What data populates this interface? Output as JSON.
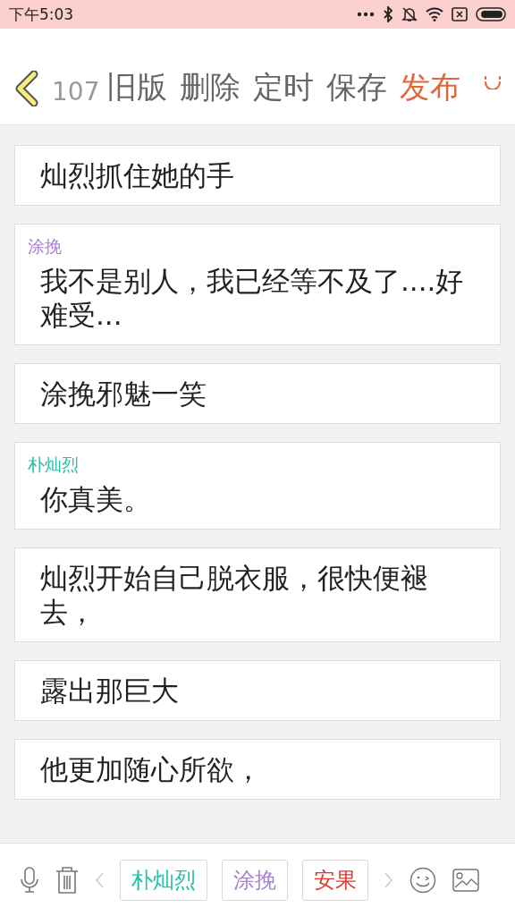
{
  "status_bar": {
    "time": "下午5:03"
  },
  "header": {
    "count": "107",
    "actions": [
      {
        "label": "旧版",
        "kind": "normal"
      },
      {
        "label": "删除",
        "kind": "normal"
      },
      {
        "label": "定时",
        "kind": "normal"
      },
      {
        "label": "保存",
        "kind": "normal"
      },
      {
        "label": "发布",
        "kind": "primary"
      }
    ]
  },
  "messages": [
    {
      "kind": "narration",
      "text": "灿烈抓住她的手"
    },
    {
      "kind": "dialogue",
      "speaker": "涂挽",
      "color": "#a97fd6",
      "text": "我不是别人，我已经等不及了....好难受..."
    },
    {
      "kind": "narration",
      "text": "涂挽邪魅一笑"
    },
    {
      "kind": "dialogue",
      "speaker": "朴灿烈",
      "color": "#2bbfa6",
      "text": "你真美。"
    },
    {
      "kind": "narration",
      "text": "灿烈开始自己脱衣服，很快便褪去，"
    },
    {
      "kind": "narration",
      "text": "露出那巨大"
    },
    {
      "kind": "narration",
      "text": "他更加随心所欲，"
    }
  ],
  "characters": [
    {
      "name": "朴灿烈",
      "color": "#2bbfa6"
    },
    {
      "name": "涂挽",
      "color": "#a97fd6"
    },
    {
      "name": "安果",
      "color": "#e0392e"
    }
  ]
}
